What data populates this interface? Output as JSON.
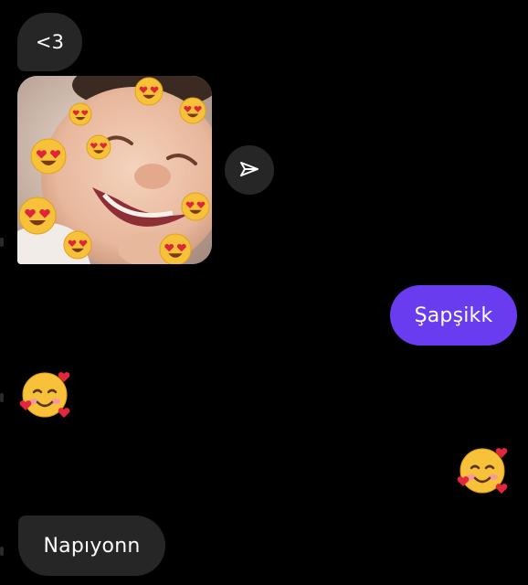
{
  "theme": {
    "background": "#000000",
    "incoming_bubble": "#262626",
    "outgoing_bubble": "#6a3cf0",
    "text": "#ffffff"
  },
  "messages": [
    {
      "id": "m1",
      "side": "incoming",
      "type": "text",
      "text": "<3"
    },
    {
      "id": "m2",
      "side": "incoming",
      "type": "image",
      "description_icon": "photo-with-heart-eyes-stickers"
    },
    {
      "id": "m3",
      "side": "outgoing",
      "type": "text",
      "text": "Şapşikk"
    },
    {
      "id": "m4",
      "side": "incoming",
      "type": "emoji",
      "emoji": "🥰"
    },
    {
      "id": "m5",
      "side": "outgoing",
      "type": "emoji",
      "emoji": "🥰"
    },
    {
      "id": "m6",
      "side": "incoming",
      "type": "text",
      "text": "Napıyonn"
    }
  ],
  "icons": {
    "share": "paper-plane-icon",
    "sticker": "heart-eyes-emoji-icon",
    "reaction": "smiling-face-with-hearts-emoji-icon"
  }
}
